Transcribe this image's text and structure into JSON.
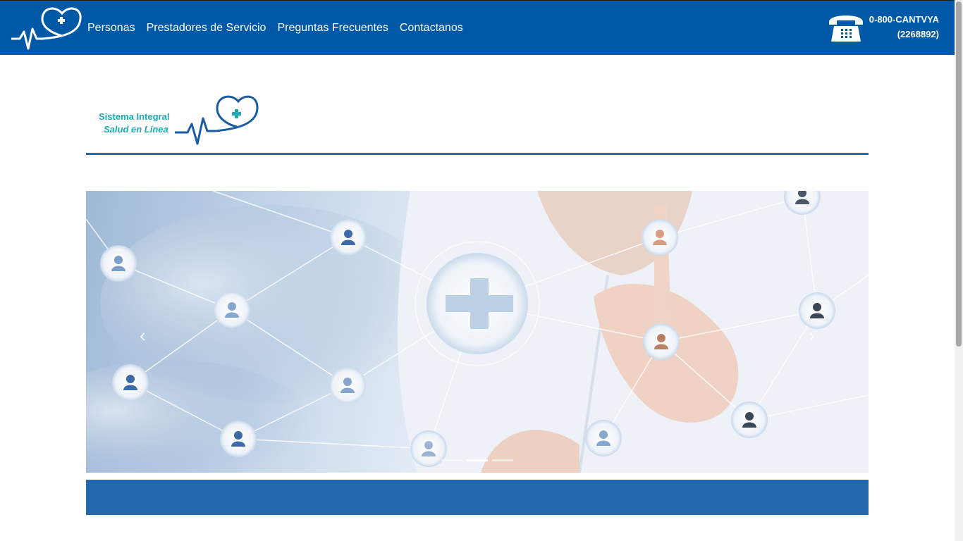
{
  "header": {
    "nav_items": [
      {
        "label": "Personas"
      },
      {
        "label": "Prestadores de Servicio"
      },
      {
        "label": "Preguntas Frecuentes"
      },
      {
        "label": "Contactanos"
      }
    ],
    "phone_line1": "0-800-CANTVYA",
    "phone_line2": "(2268892)",
    "phone_icon": "telephone-icon",
    "logo_icon": "heart-pulse-cross-icon",
    "bg_color": "#0059a6"
  },
  "brand": {
    "line1": "Sistema Integral",
    "line2": "Salud en Línea",
    "accent_color": "#1fa9b5",
    "mark_color": "#1a5ba4"
  },
  "carousel": {
    "prev_icon": "chevron-left-icon",
    "next_icon": "chevron-right-icon",
    "prev_glyph": "‹",
    "next_glyph": "›",
    "indicator_count": 3,
    "active_indicator": 1
  },
  "footer_band_color": "#2368ad"
}
